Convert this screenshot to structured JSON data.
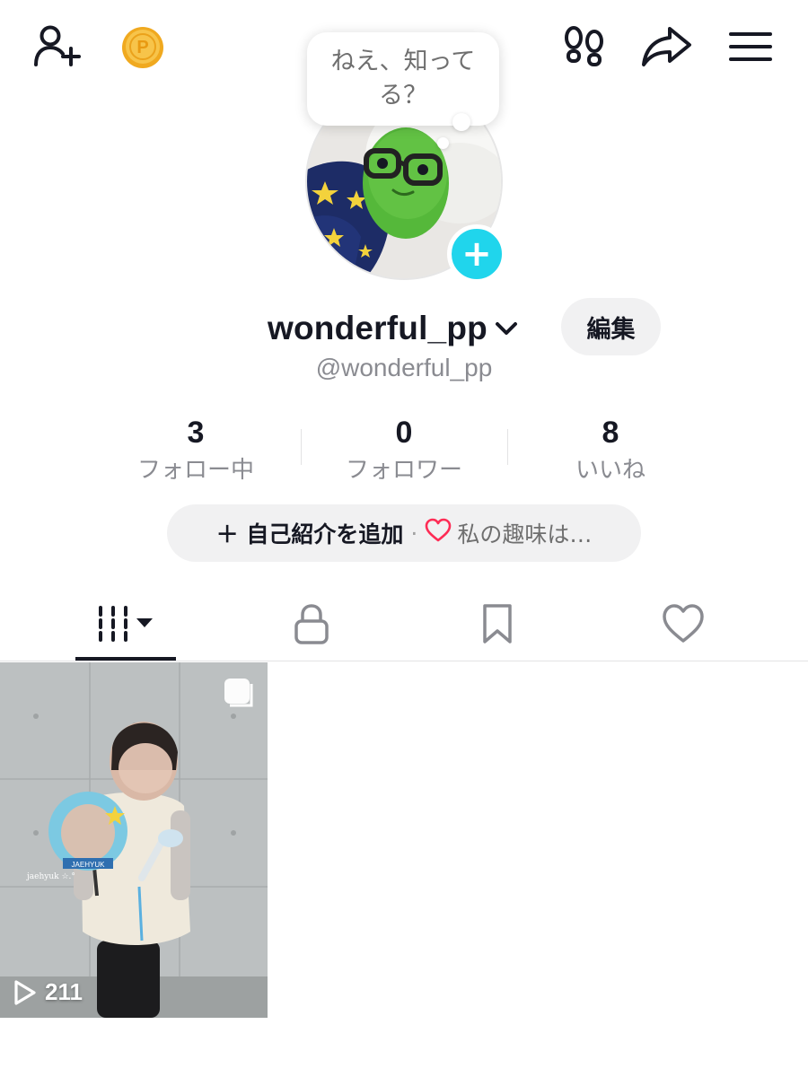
{
  "header": {
    "icons": {
      "add_user": "person-add-icon",
      "coin": "coin-icon",
      "footprints": "footprints-icon",
      "share": "share-icon",
      "menu": "menu-icon"
    },
    "coin_letter": "P",
    "bubble_text": "ねえ、知ってる？"
  },
  "profile": {
    "username": "wonderful_pp",
    "handle": "@wonderful_pp",
    "edit_label": "編集"
  },
  "stats": [
    {
      "value": "3",
      "label": "フォロー中"
    },
    {
      "value": "0",
      "label": "フォロワー"
    },
    {
      "value": "8",
      "label": "いいね"
    }
  ],
  "bio": {
    "add_label": "＋ 自己紹介を追加",
    "separator": "·",
    "hobby_label": "私の趣味は…"
  },
  "tabs": [
    {
      "icon": "grid-icon",
      "active": true
    },
    {
      "icon": "lock-icon",
      "active": false
    },
    {
      "icon": "bookmark-icon",
      "active": false
    },
    {
      "icon": "heart-icon",
      "active": false
    }
  ],
  "videos": [
    {
      "views": "211",
      "caption": "jaehyuk ☆.°",
      "fan_text": "JAEHYUK"
    }
  ],
  "colors": {
    "accent": "#20d5ec",
    "coin": "#f5b82e",
    "heart_pink": "#fe2c55",
    "text_primary": "#161823",
    "text_secondary": "#8a8b91",
    "pill_bg": "#f1f1f2"
  }
}
